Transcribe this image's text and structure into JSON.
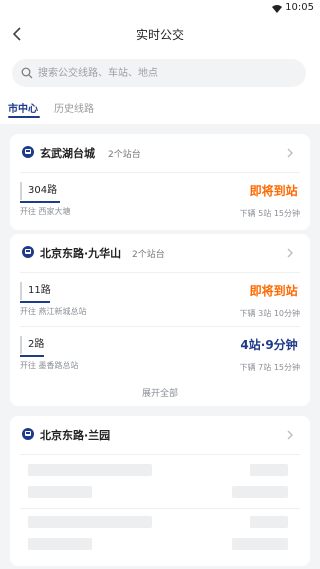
{
  "status_bar": {
    "time": "10:05"
  },
  "navbar": {
    "title": "实时公交"
  },
  "search": {
    "placeholder": "搜索公交线路、车站、地点"
  },
  "tabs": [
    {
      "label": "市中心",
      "active": true
    },
    {
      "label": "历史线路",
      "active": false
    }
  ],
  "stops": [
    {
      "name": "玄武湖台城",
      "count": "2个站台",
      "routes": [
        {
          "line": "304路",
          "direction": "开往 西家大塘",
          "status": "即将到站",
          "status_color": "orange",
          "next": "下辆 5站 15分钟"
        }
      ]
    },
    {
      "name": "北京东路·九华山",
      "count": "2个站台",
      "routes": [
        {
          "line": "11路",
          "direction": "开往 燕江新城总站",
          "status": "即将到站",
          "status_color": "orange",
          "next": "下辆 3站 10分钟"
        },
        {
          "line": "2路",
          "direction": "开往 墨香路总站",
          "status": "4站·9分钟",
          "status_color": "blue",
          "next": "下辆 7站 15分钟"
        }
      ],
      "expand_label": "展开全部"
    },
    {
      "name": "北京东路·兰园",
      "count": ""
    }
  ],
  "colors": {
    "accent": "#1e3a8a",
    "arriving": "#ff6a00"
  }
}
